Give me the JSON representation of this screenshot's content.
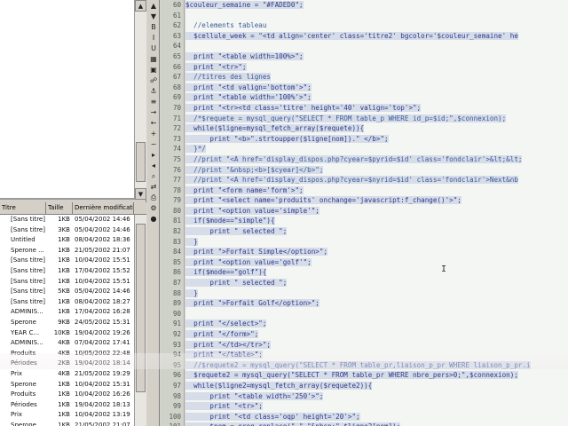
{
  "file_list": {
    "headers": [
      "Titre",
      "Taille",
      "Dernière modificati"
    ],
    "rows": [
      [
        "[Sans titre]",
        "1KB",
        "05/04/2002 14:46"
      ],
      [
        "[Sans titre]",
        "3KB",
        "05/04/2002 14:46"
      ],
      [
        "Untitled",
        "1KB",
        "08/04/2002 18:36"
      ],
      [
        "Sperone ...",
        "1KB",
        "21/05/2002 21:07"
      ],
      [
        "[Sans titre]",
        "1KB",
        "10/04/2002 15:51"
      ],
      [
        "[Sans titre]",
        "1KB",
        "17/04/2002 15:52"
      ],
      [
        "[Sans titre]",
        "1KB",
        "10/04/2002 15:51"
      ],
      [
        "[Sans titre]",
        "5KB",
        "05/04/2002 14:46"
      ],
      [
        "[Sans titre]",
        "1KB",
        "08/04/2002 18:27"
      ],
      [
        "ADMINIS...",
        "1KB",
        "17/04/2002 16:28"
      ],
      [
        "Sperone",
        "9KB",
        "24/05/2002 15:31"
      ],
      [
        "YEAR C...",
        "10KB",
        "19/04/2002 19:26"
      ],
      [
        "ADMINIS...",
        "4KB",
        "07/04/2002 17:41"
      ],
      [
        "Produits",
        "4KB",
        "10/05/2002 22:48"
      ],
      [
        "Périodes",
        "2KB",
        "19/04/2002 18:14"
      ],
      [
        "Prix",
        "4KB",
        "21/05/2002 19:29"
      ],
      [
        "Sperone",
        "1KB",
        "10/04/2002 15:31"
      ],
      [
        "Produits",
        "1KB",
        "10/04/2002 16:26"
      ],
      [
        "Périodes",
        "1KB",
        "19/04/2002 18:13"
      ],
      [
        "Prix",
        "1KB",
        "10/04/2002 13:19"
      ],
      [
        "Sperone",
        "1KB",
        "21/05/2002 21:07"
      ]
    ]
  },
  "toolbar_icons": [
    "arrow-up-icon",
    "arrow-down-icon",
    "bold-icon",
    "italic-icon",
    "underline-icon",
    "table-icon",
    "image-icon",
    "link-icon",
    "anchor-icon",
    "list-icon",
    "indent-icon",
    "outdent-icon",
    "plus-icon",
    "minus-icon",
    "arrow-right-icon",
    "arrow-left-icon",
    "search-icon",
    "replace-icon",
    "print-icon",
    "gear-icon",
    "record-icon"
  ],
  "toolbar_glyphs": [
    "▲",
    "▼",
    "B",
    "I",
    "U",
    "▦",
    "▣",
    "☍",
    "⚓",
    "≡",
    "→",
    "←",
    "+",
    "−",
    "▸",
    "◂",
    "⌕",
    "⇄",
    "⎙",
    "⚙",
    "●"
  ],
  "editor": {
    "lines": [
      {
        "n": "60",
        "text": "$couleur_semaine = \"#FADED0\";"
      },
      {
        "n": "61",
        "text": ""
      },
      {
        "n": "62",
        "text": "  //elements tableau"
      },
      {
        "n": "63",
        "text": "  $cellule_week = \"<td align='center' class='titre2' bgcolor='$couleur_semaine' he"
      },
      {
        "n": "64",
        "text": ""
      },
      {
        "n": "65",
        "text": "  print \"<table width=100%>\";"
      },
      {
        "n": "66",
        "text": "  print \"<tr>\";"
      },
      {
        "n": "67",
        "text": "  //titres des lignes"
      },
      {
        "n": "68",
        "text": "  print \"<td valign='bottom'>\";"
      },
      {
        "n": "69",
        "text": "  print \"<table width='100%'>\";"
      },
      {
        "n": "70",
        "text": "  print \"<tr><td class='titre' height='40' valign='top'>\";"
      },
      {
        "n": "71",
        "text": "  /*$requete = mysql_query(\"SELECT * FROM table_p WHERE id_p=$id;\",$connexion);"
      },
      {
        "n": "72",
        "text": "  while($ligne=mysql_fetch_array($requete)){"
      },
      {
        "n": "73",
        "text": "      print \"<b>\".strtoupper($ligne[nom]).\" </b>\";"
      },
      {
        "n": "74",
        "text": "  }*/"
      },
      {
        "n": "75",
        "text": "  //print \"<A href='display_dispos.php?cyear=$pyrid=$id' class='fondclair'>&lt;&lt;"
      },
      {
        "n": "76",
        "text": "  //print \"&nbsp;<b>[$cyear]</b>\";"
      },
      {
        "n": "77",
        "text": "  //print \"<A href='display_dispos.php?cyear=$nyrid=$id' class='fondclair'>Next&nb"
      },
      {
        "n": "78",
        "text": "  print \"<form name='form'>\";"
      },
      {
        "n": "79",
        "text": "  print \"<select name='produits' onchange='javascript:f_change()'>\";"
      },
      {
        "n": "80",
        "text": "  print \"<option value='simple'\";"
      },
      {
        "n": "81",
        "text": "  if($mode==\"simple\"){"
      },
      {
        "n": "82",
        "text": "      print \" selected \";"
      },
      {
        "n": "83",
        "text": "  }"
      },
      {
        "n": "84",
        "text": "  print \">Forfait Simple</option>\";"
      },
      {
        "n": "85",
        "text": "  print \"<option value='golf'\";"
      },
      {
        "n": "86",
        "text": "  if($mode==\"golf\"){"
      },
      {
        "n": "87",
        "text": "      print \" selected \";"
      },
      {
        "n": "88",
        "text": "  }"
      },
      {
        "n": "89",
        "text": "  print \">Forfait Golf</option>\";"
      },
      {
        "n": "90",
        "text": ""
      },
      {
        "n": "91",
        "text": "  print \"</select>\";"
      },
      {
        "n": "92",
        "text": "  print \"</form>\";"
      },
      {
        "n": "93",
        "text": "  print \"</td></tr>\";"
      },
      {
        "n": "94",
        "text": "  print \"</table>\";"
      },
      {
        "n": "95",
        "text": "  //$requete2 = mysql_query(\"SELECT * FROM table_pr,liaison_p_pr WHERE liaison_p_pr.i"
      },
      {
        "n": "96",
        "text": "  $requete2 = mysql_query(\"SELECT * FROM table_pr WHERE nbre_pers>0;\",$connexion);"
      },
      {
        "n": "97",
        "text": "  while($ligne2=mysql_fetch_array($requete2)){"
      },
      {
        "n": "98",
        "text": "      print \"<table width='250'>\";"
      },
      {
        "n": "99",
        "text": "      print \"<tr>\";"
      },
      {
        "n": "100",
        "text": "      print \"<td class='oqp' height='20'>\";"
      },
      {
        "n": "101",
        "text": "      $nom = ereg_replace(\" \",\"&nbsp;\",$ligne2[nom]);"
      }
    ]
  },
  "colors": {
    "editor_bg": "#f4f6f3",
    "gutter_bg": "#cfd2c8",
    "code_text": "#2a3a8a",
    "line_highlight": "#d6dce8"
  }
}
